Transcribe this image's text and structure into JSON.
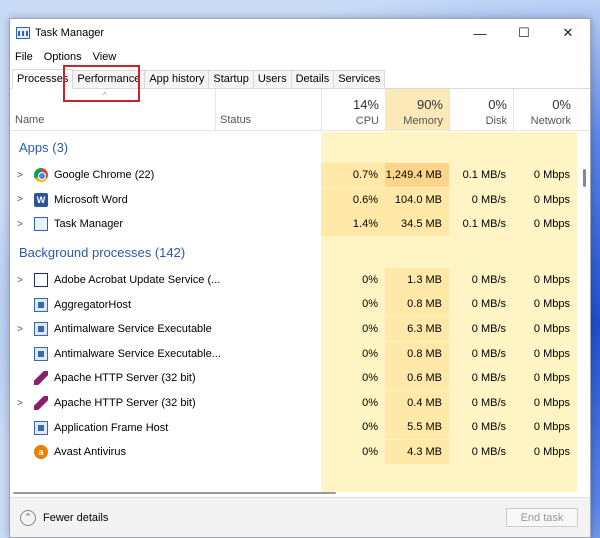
{
  "window": {
    "title": "Task Manager"
  },
  "controls": {
    "minimize": "—",
    "maximize": "☐",
    "close": "✕"
  },
  "menu": [
    "File",
    "Options",
    "View"
  ],
  "tabs": [
    "Processes",
    "Performance",
    "App history",
    "Startup",
    "Users",
    "Details",
    "Services"
  ],
  "active_tab": "Processes",
  "highlighted_tab": "Performance",
  "columns": {
    "name": "Name",
    "status": "Status",
    "cpu": {
      "pct": "14%",
      "label": "CPU"
    },
    "memory": {
      "pct": "90%",
      "label": "Memory"
    },
    "disk": {
      "pct": "0%",
      "label": "Disk"
    },
    "network": {
      "pct": "0%",
      "label": "Network"
    }
  },
  "groups": [
    {
      "title": "Apps (3)",
      "rows": [
        {
          "name": "Google Chrome (22)",
          "icon": "chrome-icon",
          "expandable": true,
          "cpu": "0.7%",
          "memory": "1,249.4 MB",
          "disk": "0.1 MB/s",
          "network": "0 Mbps"
        },
        {
          "name": "Microsoft Word",
          "icon": "word-icon",
          "expandable": true,
          "cpu": "0.6%",
          "memory": "104.0 MB",
          "disk": "0 MB/s",
          "network": "0 Mbps"
        },
        {
          "name": "Task Manager",
          "icon": "task-manager-icon",
          "expandable": true,
          "cpu": "1.4%",
          "memory": "34.5 MB",
          "disk": "0.1 MB/s",
          "network": "0 Mbps"
        }
      ]
    },
    {
      "title": "Background processes (142)",
      "rows": [
        {
          "name": "Adobe Acrobat Update Service (...",
          "icon": "window-icon",
          "expandable": true,
          "cpu": "0%",
          "memory": "1.3 MB",
          "disk": "0 MB/s",
          "network": "0 Mbps"
        },
        {
          "name": "AggregatorHost",
          "icon": "service-icon",
          "expandable": false,
          "cpu": "0%",
          "memory": "0.8 MB",
          "disk": "0 MB/s",
          "network": "0 Mbps"
        },
        {
          "name": "Antimalware Service Executable",
          "icon": "service-icon",
          "expandable": true,
          "cpu": "0%",
          "memory": "6.3 MB",
          "disk": "0 MB/s",
          "network": "0 Mbps"
        },
        {
          "name": "Antimalware Service Executable...",
          "icon": "service-icon",
          "expandable": false,
          "cpu": "0%",
          "memory": "0.8 MB",
          "disk": "0 MB/s",
          "network": "0 Mbps"
        },
        {
          "name": "Apache HTTP Server (32 bit)",
          "icon": "feather-icon",
          "expandable": false,
          "cpu": "0%",
          "memory": "0.6 MB",
          "disk": "0 MB/s",
          "network": "0 Mbps"
        },
        {
          "name": "Apache HTTP Server (32 bit)",
          "icon": "feather-icon",
          "expandable": true,
          "cpu": "0%",
          "memory": "0.4 MB",
          "disk": "0 MB/s",
          "network": "0 Mbps"
        },
        {
          "name": "Application Frame Host",
          "icon": "service-icon",
          "expandable": false,
          "cpu": "0%",
          "memory": "5.5 MB",
          "disk": "0 MB/s",
          "network": "0 Mbps"
        },
        {
          "name": "Avast Antivirus",
          "icon": "avast-icon",
          "expandable": false,
          "cpu": "0%",
          "memory": "4.3 MB",
          "disk": "0 MB/s",
          "network": "0 Mbps"
        }
      ]
    }
  ],
  "footer": {
    "fewer_details": "Fewer details",
    "end_task": "End task"
  },
  "heat_colors": {
    "light": "#fff4c4",
    "medium": "#ffe8a8",
    "strong": "#fdd58a"
  }
}
